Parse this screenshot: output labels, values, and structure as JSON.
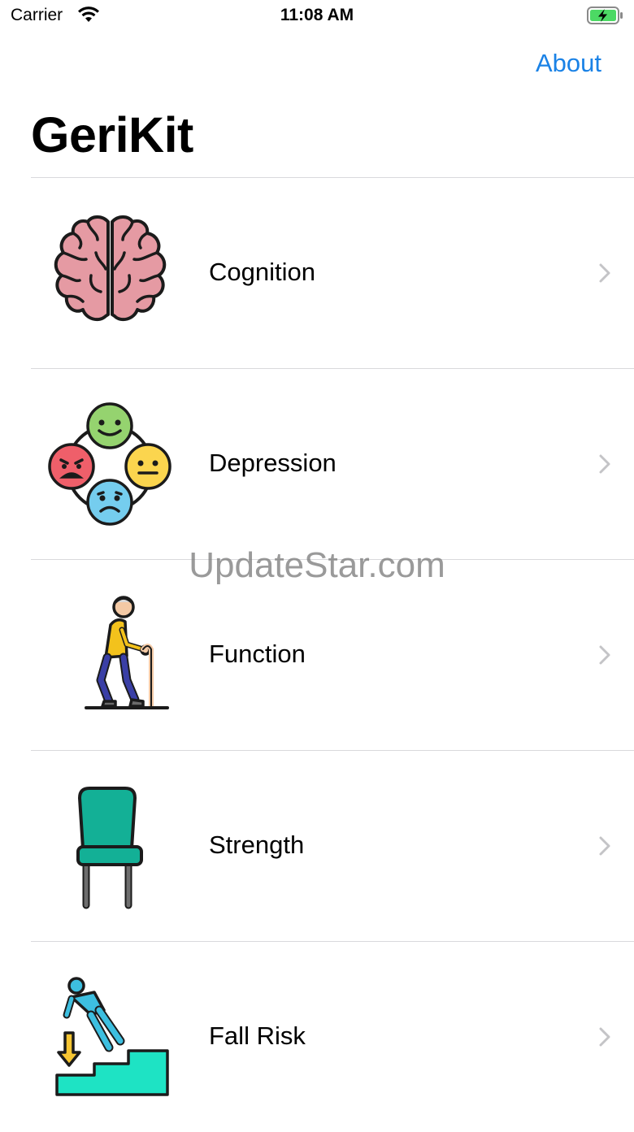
{
  "status_bar": {
    "carrier": "Carrier",
    "time": "11:08 AM"
  },
  "nav": {
    "about_label": "About",
    "title": "GeriKit"
  },
  "items": [
    {
      "label": "Cognition",
      "icon": "brain-icon"
    },
    {
      "label": "Depression",
      "icon": "mood-faces-icon"
    },
    {
      "label": "Function",
      "icon": "elderly-walking-icon"
    },
    {
      "label": "Strength",
      "icon": "chair-icon"
    },
    {
      "label": "Fall Risk",
      "icon": "fall-stairs-icon"
    }
  ],
  "watermark": "UpdateStar.com",
  "colors": {
    "accent": "#1a82e6",
    "separator": "#d9d9dc",
    "chevron": "#c4c4c7"
  }
}
